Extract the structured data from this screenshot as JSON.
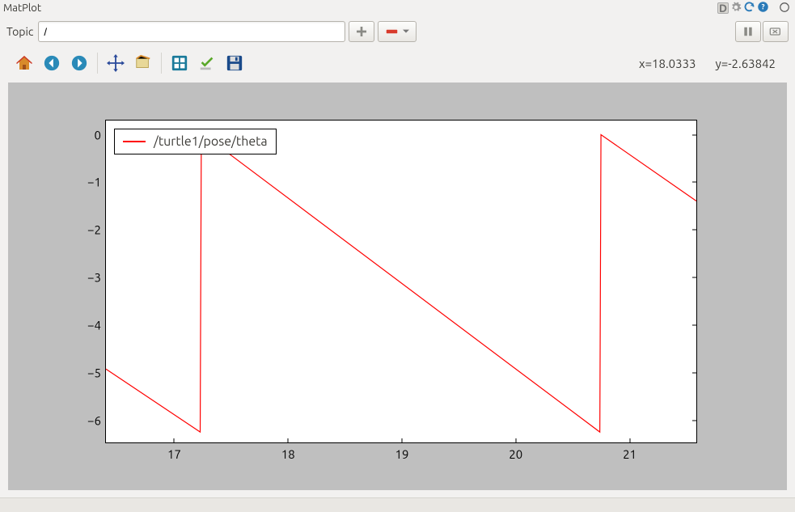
{
  "window": {
    "title": "MatPlot"
  },
  "titlebar_icons": {
    "d": "D",
    "gear": "gear-icon",
    "refresh": "refresh-icon",
    "help": "help-icon",
    "restore": "restore-icon"
  },
  "topic": {
    "label": "Topic",
    "value": "/",
    "add_label": "+",
    "remove_label": "−"
  },
  "run_controls": {
    "pause": "pause-button",
    "clear": "clear-button"
  },
  "toolbar": {
    "home": "home-icon",
    "back": "back-icon",
    "forward": "forward-icon",
    "pan": "pan-icon",
    "zoom": "zoom-icon",
    "subplots": "subplots-icon",
    "edit": "edit-icon",
    "save": "save-icon"
  },
  "coords": {
    "x_label": "x=18.0333",
    "y_label": "y=-2.63842"
  },
  "chart_data": {
    "type": "line",
    "title": "",
    "xlabel": "",
    "ylabel": "",
    "xlim": [
      16.4,
      21.6
    ],
    "ylim": [
      -6.5,
      0.3
    ],
    "xticks": [
      17,
      18,
      19,
      20,
      21
    ],
    "yticks": [
      0,
      -1,
      -2,
      -3,
      -4,
      -5,
      -6
    ],
    "series": [
      {
        "name": "/turtle1/pose/theta",
        "color": "#ff0000",
        "x": [
          16.4,
          17.23,
          17.24,
          17.4,
          20.75,
          20.76,
          21.6
        ],
        "y": [
          -4.95,
          -6.28,
          0.0,
          -0.25,
          -6.28,
          0.0,
          -1.4
        ]
      }
    ],
    "legend": {
      "position": "upper left"
    }
  }
}
